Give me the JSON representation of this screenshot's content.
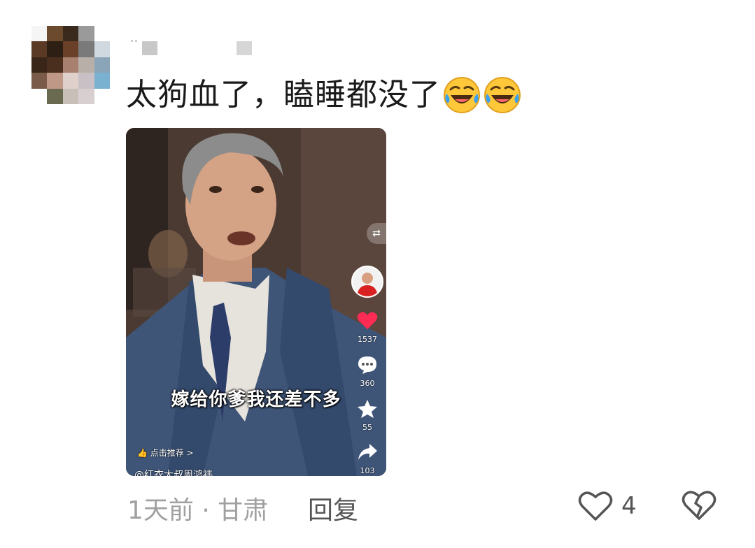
{
  "comment": {
    "text": "太狗血了，瞌睡都没了",
    "emojis": [
      "laugh-cry-emoji",
      "laugh-cry-emoji"
    ]
  },
  "video": {
    "subtitle": "嫁给你爹我还差不多",
    "switch_icon": "⇄",
    "actions": {
      "likes": "1537",
      "comments": "360",
      "favorites": "55",
      "shares": "103"
    },
    "recommend_label": "点击推荐 >",
    "creator_handle": "@红衣大叔周鸿祎"
  },
  "footer": {
    "meta": "1天前 · 甘肃",
    "reply_label": "回复",
    "like_count": "4"
  },
  "colors": {
    "heart": "#fe2c55",
    "text_primary": "#1a1a1a",
    "text_muted": "#a0a0a0"
  }
}
